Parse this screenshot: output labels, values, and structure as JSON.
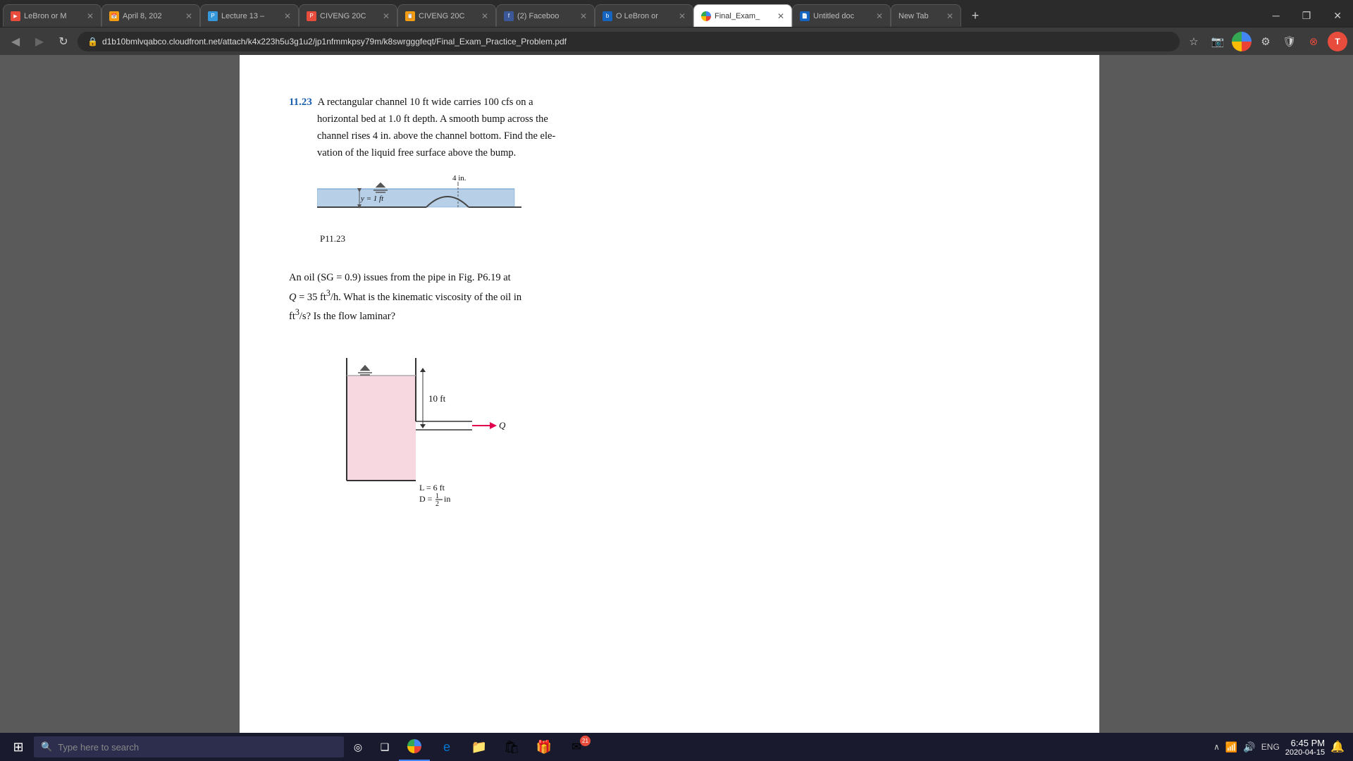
{
  "browser": {
    "tabs": [
      {
        "id": "tab1",
        "title": "LeBron or M",
        "active": false,
        "favicon_color": "#e74c3c",
        "favicon_char": "▶"
      },
      {
        "id": "tab2",
        "title": "April 8, 202",
        "active": false,
        "favicon_color": "#f39c12",
        "favicon_char": "📅"
      },
      {
        "id": "tab3",
        "title": "Lecture 13 –",
        "active": false,
        "favicon_color": "#3498db",
        "favicon_char": "P"
      },
      {
        "id": "tab4",
        "title": "CIVENG 20C",
        "active": false,
        "favicon_color": "#e74c3c",
        "favicon_char": "P"
      },
      {
        "id": "tab5",
        "title": "CIVENG 20C",
        "active": false,
        "favicon_color": "#f39c12",
        "favicon_char": "📋"
      },
      {
        "id": "tab6",
        "title": "(2) Faceboo",
        "active": false,
        "favicon_color": "#3b5998",
        "favicon_char": "f"
      },
      {
        "id": "tab7",
        "title": "O LeBron or",
        "active": false,
        "favicon_color": "#1565c0",
        "favicon_char": "b"
      },
      {
        "id": "tab8",
        "title": "Final_Exam_",
        "active": true,
        "favicon_color": "#4285f4",
        "favicon_char": "🌐"
      },
      {
        "id": "tab9",
        "title": "Untitled doc",
        "active": false,
        "favicon_color": "#1565c0",
        "favicon_char": "📄"
      },
      {
        "id": "tab10",
        "title": "New Tab",
        "active": false,
        "favicon_color": "#aaa",
        "favicon_char": ""
      }
    ],
    "url": "d1b10bmlvqabco.cloudfront.net/attach/k4x223h5u3g1u2/jp1nfmmkpsy79m/k8swrgggfeqt/Final_Exam_Practice_Problem.pdf",
    "nav": {
      "back": "◀",
      "forward": "▶",
      "refresh": "↻"
    }
  },
  "pdf": {
    "problem1": {
      "number": "11.23",
      "text_line1": "A rectangular channel 10 ft wide carries 100 cfs on a",
      "text_line2": "horizontal bed at 1.0 ft depth. A smooth bump across the",
      "text_line3": "channel rises 4 in. above the channel bottom. Find the ele-",
      "text_line4": "vation of the liquid free surface above the bump.",
      "diagram_label": "P11.23",
      "y_label": "y = 1 ft",
      "bump_label": "4 in."
    },
    "problem2": {
      "text_line1": "An oil (SG = 0.9) issues from the pipe in Fig. P6.19 at",
      "text_line2": "Q = 35 ft³/h. What is the kinematic viscosity of the oil in",
      "text_line3": "ft³/s? Is the flow laminar?",
      "tank_height": "10 ft",
      "pipe_length": "L = 6 ft",
      "pipe_diameter": "D = ½ in",
      "flow_label": "Q"
    }
  },
  "taskbar": {
    "search_placeholder": "Type here to search",
    "apps": [
      {
        "name": "windows-icon",
        "char": "⊞"
      },
      {
        "name": "cortana-search",
        "char": "🔍"
      },
      {
        "name": "task-view",
        "char": "❑"
      },
      {
        "name": "chrome-app",
        "char": "🌐"
      },
      {
        "name": "edge-app",
        "char": "e"
      },
      {
        "name": "explorer-app",
        "char": "📁"
      },
      {
        "name": "store-app",
        "char": "🛍"
      },
      {
        "name": "gift-app",
        "char": "🎁"
      },
      {
        "name": "mail-app",
        "char": "✉",
        "badge": "21"
      }
    ],
    "time": "6:45 PM",
    "date": "2020-04-15",
    "language": "ENG"
  }
}
